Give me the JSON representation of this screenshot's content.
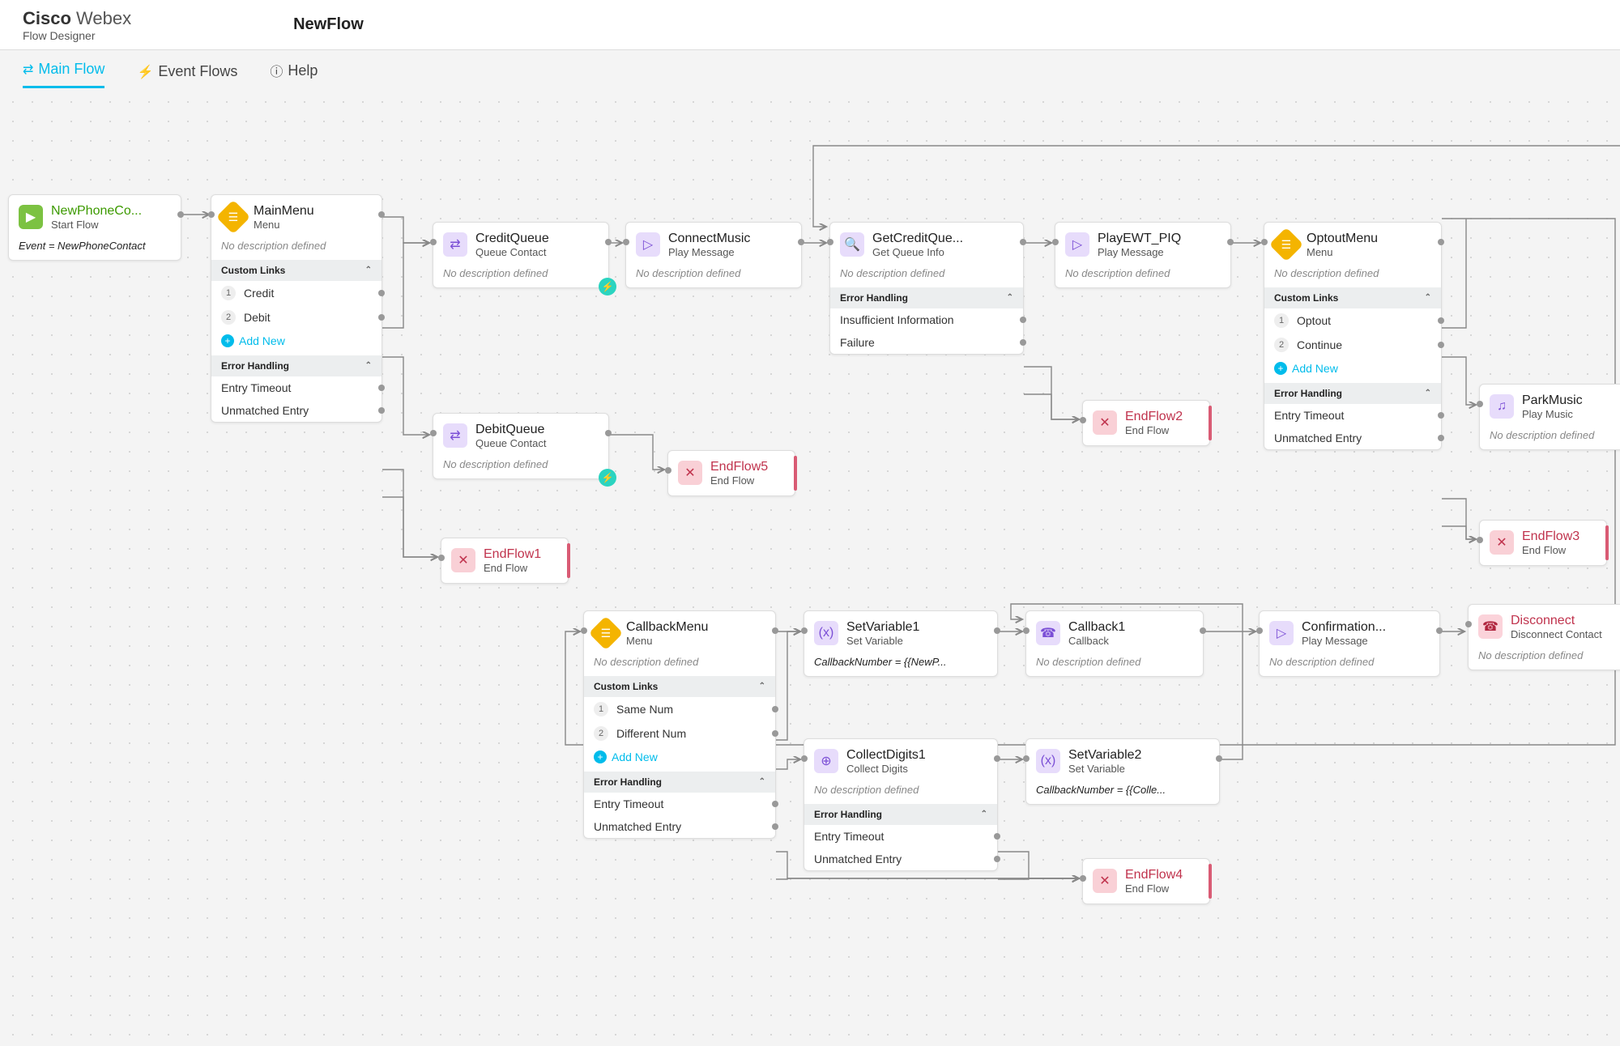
{
  "brand": {
    "b": "Cisco",
    "w": " Webex",
    "app": "Flow Designer",
    "flow": "NewFlow"
  },
  "tabs": {
    "main": "Main Flow",
    "events": "Event Flows",
    "help": "Help"
  },
  "txt": {
    "nodesc": "No description defined",
    "custom": "Custom Links",
    "errh": "Error Handling",
    "add": "Add New",
    "etimeout": "Entry Timeout",
    "unmatch": "Unmatched Entry",
    "insuf": "Insufficient Information",
    "fail": "Failure"
  },
  "start": {
    "title": "NewPhoneCo...",
    "sub": "Start Flow",
    "expr": "Event = NewPhoneContact"
  },
  "main_menu": {
    "title": "MainMenu",
    "sub": "Menu",
    "link1": "Credit",
    "link2": "Debit"
  },
  "creditq": {
    "title": "CreditQueue",
    "sub": "Queue Contact"
  },
  "debitq": {
    "title": "DebitQueue",
    "sub": "Queue Contact"
  },
  "connectmusic": {
    "title": "ConnectMusic",
    "sub": "Play Message"
  },
  "getcredit": {
    "title": "GetCreditQue...",
    "sub": "Get Queue Info"
  },
  "playewt": {
    "title": "PlayEWT_PIQ",
    "sub": "Play Message"
  },
  "optout": {
    "title": "OptoutMenu",
    "sub": "Menu",
    "link1": "Optout",
    "link2": "Continue"
  },
  "park": {
    "title": "ParkMusic",
    "sub": "Play Music"
  },
  "ef1": {
    "title": "EndFlow1",
    "sub": "End Flow"
  },
  "ef2": {
    "title": "EndFlow2",
    "sub": "End Flow"
  },
  "ef3": {
    "title": "EndFlow3",
    "sub": "End Flow"
  },
  "ef4": {
    "title": "EndFlow4",
    "sub": "End Flow"
  },
  "ef5": {
    "title": "EndFlow5",
    "sub": "End Flow"
  },
  "cbmenu": {
    "title": "CallbackMenu",
    "sub": "Menu",
    "link1": "Same Num",
    "link2": "Different Num"
  },
  "setvar1": {
    "title": "SetVariable1",
    "sub": "Set Variable",
    "expr": "CallbackNumber = {{NewP..."
  },
  "setvar2": {
    "title": "SetVariable2",
    "sub": "Set Variable",
    "expr": "CallbackNumber = {{Colle..."
  },
  "collect": {
    "title": "CollectDigits1",
    "sub": "Collect Digits"
  },
  "callback": {
    "title": "Callback1",
    "sub": "Callback"
  },
  "confirm": {
    "title": "Confirmation...",
    "sub": "Play Message"
  },
  "disconnect": {
    "title": "Disconnect",
    "sub": "Disconnect Contact"
  }
}
